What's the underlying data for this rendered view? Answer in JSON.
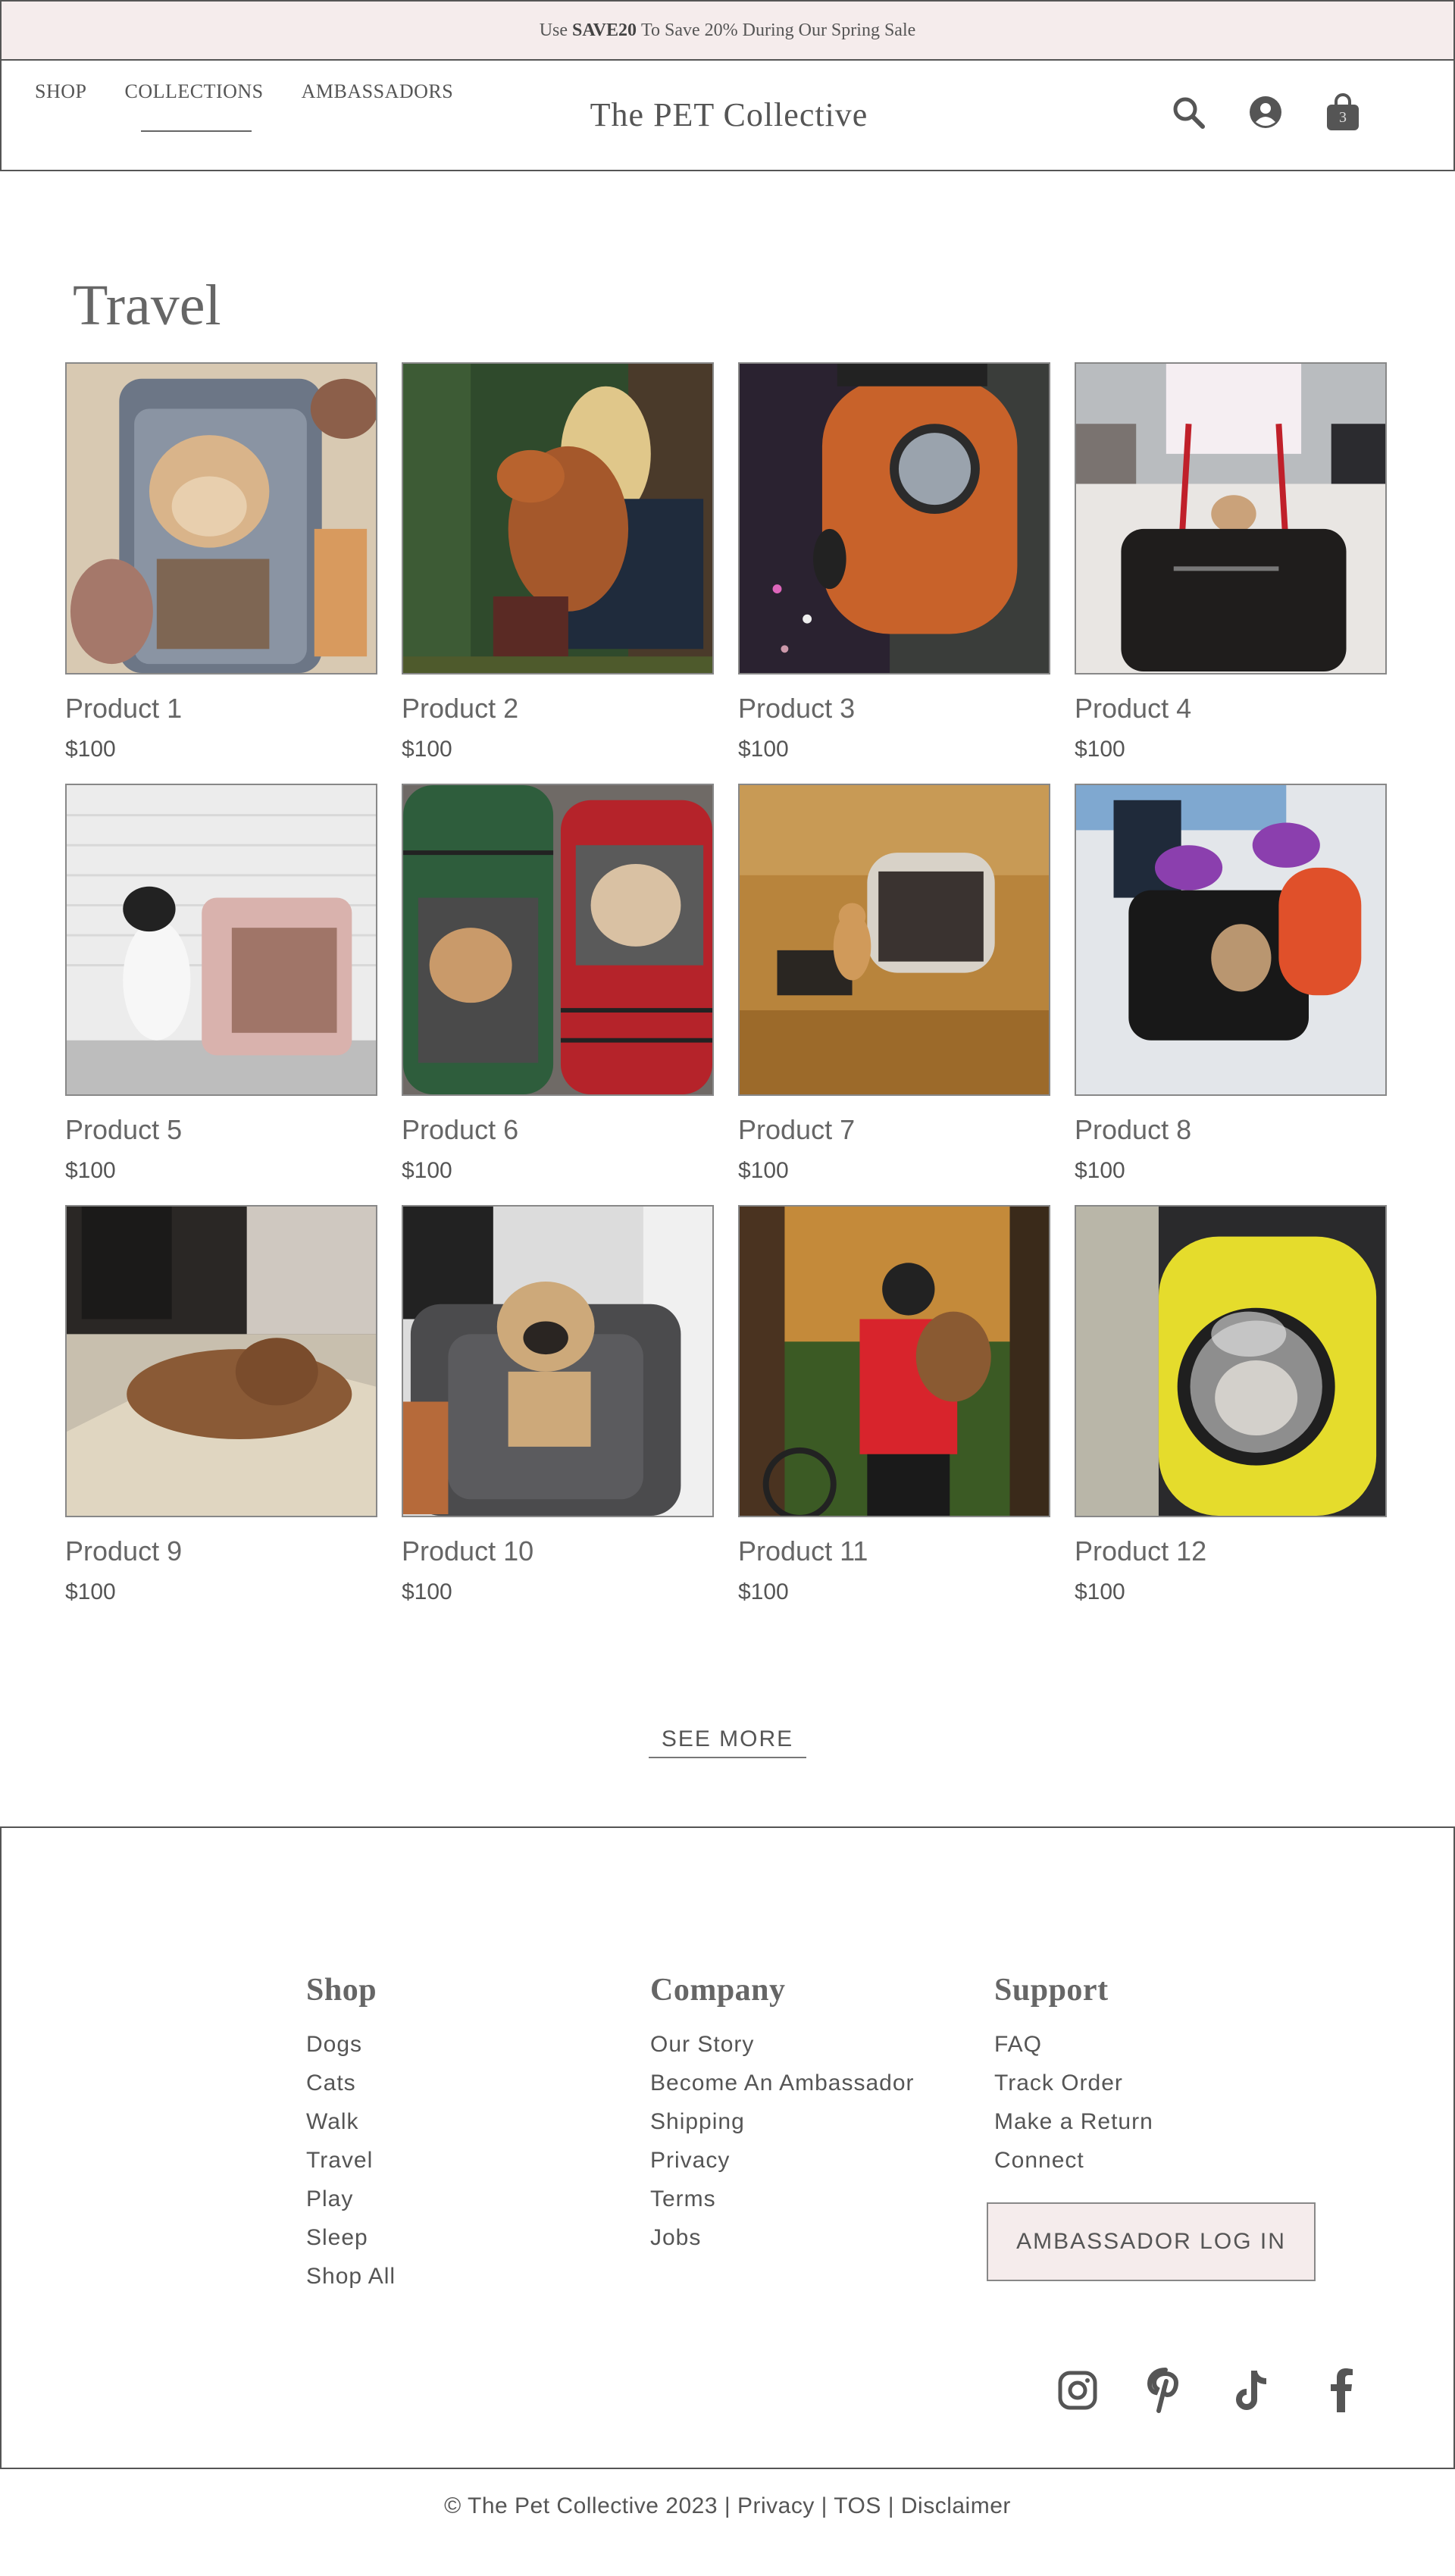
{
  "promo": {
    "prefix": "Use",
    "code": "SAVE20",
    "suffix": "To Save 20% During Our Spring Sale"
  },
  "nav": {
    "shop": "SHOP",
    "collections": "COLLECTIONS",
    "ambassadors": "AMBASSADORS"
  },
  "brand": "The PET Collective",
  "cart_count": "3",
  "page_title": "Travel",
  "products": [
    {
      "name": "Product 1",
      "price": "$100"
    },
    {
      "name": "Product 2",
      "price": "$100"
    },
    {
      "name": "Product 3",
      "price": "$100"
    },
    {
      "name": "Product 4",
      "price": "$100"
    },
    {
      "name": "Product 5",
      "price": "$100"
    },
    {
      "name": "Product 6",
      "price": "$100"
    },
    {
      "name": "Product 7",
      "price": "$100"
    },
    {
      "name": "Product 8",
      "price": "$100"
    },
    {
      "name": "Product 9",
      "price": "$100"
    },
    {
      "name": "Product 10",
      "price": "$100"
    },
    {
      "name": "Product 11",
      "price": "$100"
    },
    {
      "name": "Product 12",
      "price": "$100"
    }
  ],
  "see_more": "SEE MORE",
  "footer": {
    "shop": {
      "heading": "Shop",
      "links": [
        "Dogs",
        "Cats",
        "Walk",
        "Travel",
        "Play",
        "Sleep",
        "Shop All"
      ]
    },
    "company": {
      "heading": "Company",
      "links": [
        "Our Story",
        "Become An Ambassador",
        "Shipping",
        "Privacy",
        "Terms",
        "Jobs"
      ]
    },
    "support": {
      "heading": "Support",
      "links": [
        "FAQ",
        "Track Order",
        "Make a Return",
        "Connect"
      ]
    },
    "ambassador_login": "AMBASSADOR LOG IN"
  },
  "copyright": "© The Pet Collective 2023 | Privacy | TOS | Disclaimer",
  "colors": {
    "promo_bg": "#f5ecec",
    "text": "#555555",
    "border": "#555555"
  }
}
